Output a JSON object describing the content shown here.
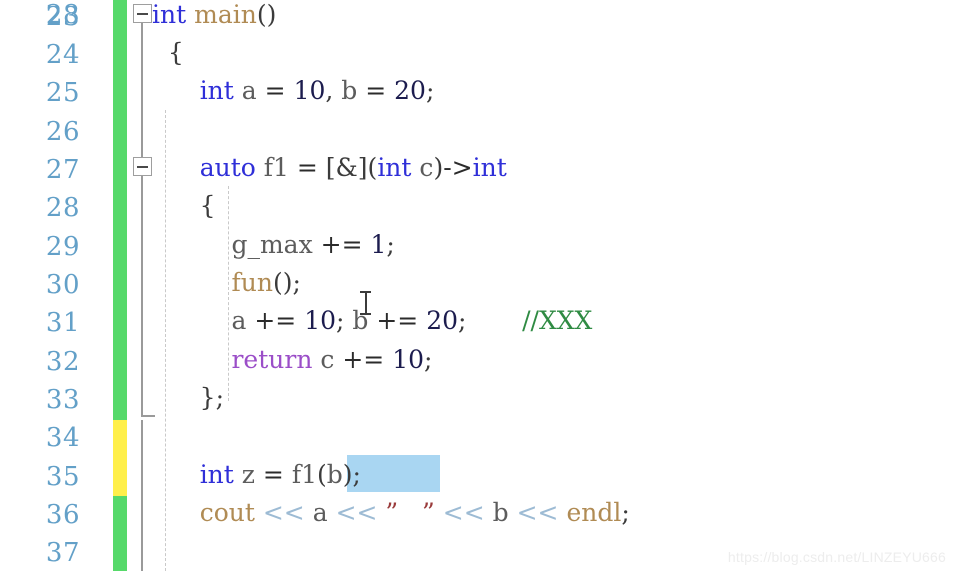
{
  "editor": {
    "language": "C++",
    "colors": {
      "background": "#ffffff",
      "line_number": "#63a0c8",
      "keyword": "#2f2fd8",
      "control_keyword": "#9b4ec8",
      "function": "#b08b54",
      "identifier": "#5c5c5c",
      "number": "#1c1c4e",
      "comment": "#2f8b43",
      "stream_operator": "#9dbbd4",
      "selection": "#a9d6f2",
      "margin_saved": "#56d96a",
      "margin_unsaved": "#ffef4a",
      "fold_line": "#9a9a9a",
      "indent_guide": "#c9c9c9",
      "watermark": "#ededed"
    }
  },
  "gutter": {
    "line_numbers": [
      "23",
      "24",
      "25",
      "26",
      "27",
      "28",
      "29",
      "30",
      "31",
      "32",
      "33",
      "34",
      "35",
      "36",
      "37"
    ]
  },
  "margin_strip": {
    "segments": [
      {
        "status": "saved",
        "from_line": "23",
        "to_line": "33"
      },
      {
        "status": "unsaved",
        "from_line": "34",
        "to_line": "35"
      },
      {
        "status": "saved",
        "from_line": "36",
        "to_line": "37"
      }
    ]
  },
  "folding": {
    "regions": [
      {
        "start_line": "23",
        "end_line": "37",
        "state": "expanded",
        "glyph": "minus-box"
      },
      {
        "start_line": "27",
        "end_line": "33",
        "state": "expanded",
        "glyph": "minus-box"
      }
    ]
  },
  "code": {
    "lines": [
      {
        "number": "23",
        "text": "int main()",
        "tokens": [
          {
            "t": "int",
            "c": "kw"
          },
          {
            "t": " ",
            "c": "punc"
          },
          {
            "t": "main",
            "c": "fn"
          },
          {
            "t": "()",
            "c": "punc"
          }
        ]
      },
      {
        "number": "24",
        "text": "{",
        "tokens": [
          {
            "t": "  {",
            "c": "punc"
          }
        ]
      },
      {
        "number": "25",
        "text": "    int a = 10, b = 20;",
        "tokens": [
          {
            "t": "      ",
            "c": "punc"
          },
          {
            "t": "int",
            "c": "kw"
          },
          {
            "t": " ",
            "c": "punc"
          },
          {
            "t": "a",
            "c": "id"
          },
          {
            "t": " ",
            "c": "punc"
          },
          {
            "t": "=",
            "c": "op"
          },
          {
            "t": " ",
            "c": "punc"
          },
          {
            "t": "10",
            "c": "num"
          },
          {
            "t": ", ",
            "c": "punc"
          },
          {
            "t": "b",
            "c": "id"
          },
          {
            "t": " ",
            "c": "punc"
          },
          {
            "t": "=",
            "c": "op"
          },
          {
            "t": " ",
            "c": "punc"
          },
          {
            "t": "20",
            "c": "num"
          },
          {
            "t": ";",
            "c": "punc"
          }
        ]
      },
      {
        "number": "26",
        "text": "",
        "tokens": []
      },
      {
        "number": "27",
        "text": "    auto f1 = [&](int c)->int",
        "tokens": [
          {
            "t": "      ",
            "c": "punc"
          },
          {
            "t": "auto",
            "c": "kw"
          },
          {
            "t": " ",
            "c": "punc"
          },
          {
            "t": "f1",
            "c": "id"
          },
          {
            "t": " ",
            "c": "punc"
          },
          {
            "t": "=",
            "c": "op"
          },
          {
            "t": " ",
            "c": "punc"
          },
          {
            "t": "[&]",
            "c": "punc"
          },
          {
            "t": "(",
            "c": "punc"
          },
          {
            "t": "int",
            "c": "kw"
          },
          {
            "t": " ",
            "c": "punc"
          },
          {
            "t": "c",
            "c": "id"
          },
          {
            "t": ")",
            "c": "punc"
          },
          {
            "t": "->",
            "c": "op"
          },
          {
            "t": "int",
            "c": "kw"
          }
        ]
      },
      {
        "number": "28",
        "text": "    {",
        "tokens": [
          {
            "t": "      {",
            "c": "punc"
          }
        ]
      },
      {
        "number": "29",
        "text": "        g_max += 1;",
        "tokens": [
          {
            "t": "          ",
            "c": "punc"
          },
          {
            "t": "g_max",
            "c": "id"
          },
          {
            "t": " ",
            "c": "punc"
          },
          {
            "t": "+=",
            "c": "op"
          },
          {
            "t": " ",
            "c": "punc"
          },
          {
            "t": "1",
            "c": "num"
          },
          {
            "t": ";",
            "c": "punc"
          }
        ]
      },
      {
        "number": "30",
        "text": "        fun();",
        "tokens": [
          {
            "t": "          ",
            "c": "punc"
          },
          {
            "t": "fun",
            "c": "fn"
          },
          {
            "t": "()",
            "c": "punc"
          },
          {
            "t": ";",
            "c": "punc"
          }
        ]
      },
      {
        "number": "31",
        "text": "        a += 10; b += 20;     //XXX",
        "tokens": [
          {
            "t": "          ",
            "c": "punc"
          },
          {
            "t": "a",
            "c": "id"
          },
          {
            "t": " ",
            "c": "punc"
          },
          {
            "t": "+=",
            "c": "op"
          },
          {
            "t": " ",
            "c": "punc"
          },
          {
            "t": "10",
            "c": "num"
          },
          {
            "t": "; ",
            "c": "punc"
          },
          {
            "t": "b",
            "c": "id"
          },
          {
            "t": " ",
            "c": "punc"
          },
          {
            "t": "+=",
            "c": "op"
          },
          {
            "t": " ",
            "c": "punc"
          },
          {
            "t": "20",
            "c": "num"
          },
          {
            "t": ";",
            "c": "punc"
          },
          {
            "t": "       ",
            "c": "punc"
          },
          {
            "t": "//XXX",
            "c": "cmt"
          }
        ]
      },
      {
        "number": "32",
        "text": "        return c += 10;",
        "tokens": [
          {
            "t": "          ",
            "c": "punc"
          },
          {
            "t": "return",
            "c": "ctl"
          },
          {
            "t": " ",
            "c": "punc"
          },
          {
            "t": "c",
            "c": "id"
          },
          {
            "t": " ",
            "c": "punc"
          },
          {
            "t": "+=",
            "c": "op"
          },
          {
            "t": " ",
            "c": "punc"
          },
          {
            "t": "10",
            "c": "num"
          },
          {
            "t": ";",
            "c": "punc"
          }
        ]
      },
      {
        "number": "33",
        "text": "    };",
        "tokens": [
          {
            "t": "      };",
            "c": "punc"
          }
        ]
      },
      {
        "number": "34",
        "text": "",
        "tokens": []
      },
      {
        "number": "35",
        "text": "    int z = f1(b);",
        "tokens": [
          {
            "t": "      ",
            "c": "punc"
          },
          {
            "t": "int",
            "c": "kw"
          },
          {
            "t": " ",
            "c": "punc"
          },
          {
            "t": "z",
            "c": "id"
          },
          {
            "t": " ",
            "c": "punc"
          },
          {
            "t": "=",
            "c": "op"
          },
          {
            "t": " ",
            "c": "punc"
          },
          {
            "t": "f1",
            "c": "id"
          },
          {
            "t": "(",
            "c": "punc"
          },
          {
            "t": "b",
            "c": "id"
          },
          {
            "t": ")",
            "c": "punc"
          },
          {
            "t": ";",
            "c": "punc"
          }
        ]
      },
      {
        "number": "36",
        "text": "    cout << a << \" \" << b << endl;",
        "tokens": [
          {
            "t": "      ",
            "c": "punc"
          },
          {
            "t": "cout",
            "c": "fn"
          },
          {
            "t": " ",
            "c": "punc"
          },
          {
            "t": "<<",
            "c": "shift"
          },
          {
            "t": " ",
            "c": "punc"
          },
          {
            "t": "a",
            "c": "id"
          },
          {
            "t": " ",
            "c": "punc"
          },
          {
            "t": "<<",
            "c": "shift"
          },
          {
            "t": " ",
            "c": "punc"
          },
          {
            "t": "”   ”",
            "c": "str"
          },
          {
            "t": " ",
            "c": "punc"
          },
          {
            "t": "<<",
            "c": "shift"
          },
          {
            "t": " ",
            "c": "punc"
          },
          {
            "t": "b",
            "c": "id"
          },
          {
            "t": " ",
            "c": "punc"
          },
          {
            "t": "<<",
            "c": "shift"
          },
          {
            "t": " ",
            "c": "punc"
          },
          {
            "t": "endl",
            "c": "fn"
          },
          {
            "t": ";",
            "c": "punc"
          }
        ]
      },
      {
        "number": "37",
        "text": "",
        "tokens": []
      }
    ]
  },
  "selection": {
    "line": "35",
    "selected_text": "f1(b);"
  },
  "cursor": {
    "type": "ibeam",
    "near_line": "31"
  },
  "watermark": {
    "text": "https://blog.csdn.net/LINZEYU666"
  }
}
